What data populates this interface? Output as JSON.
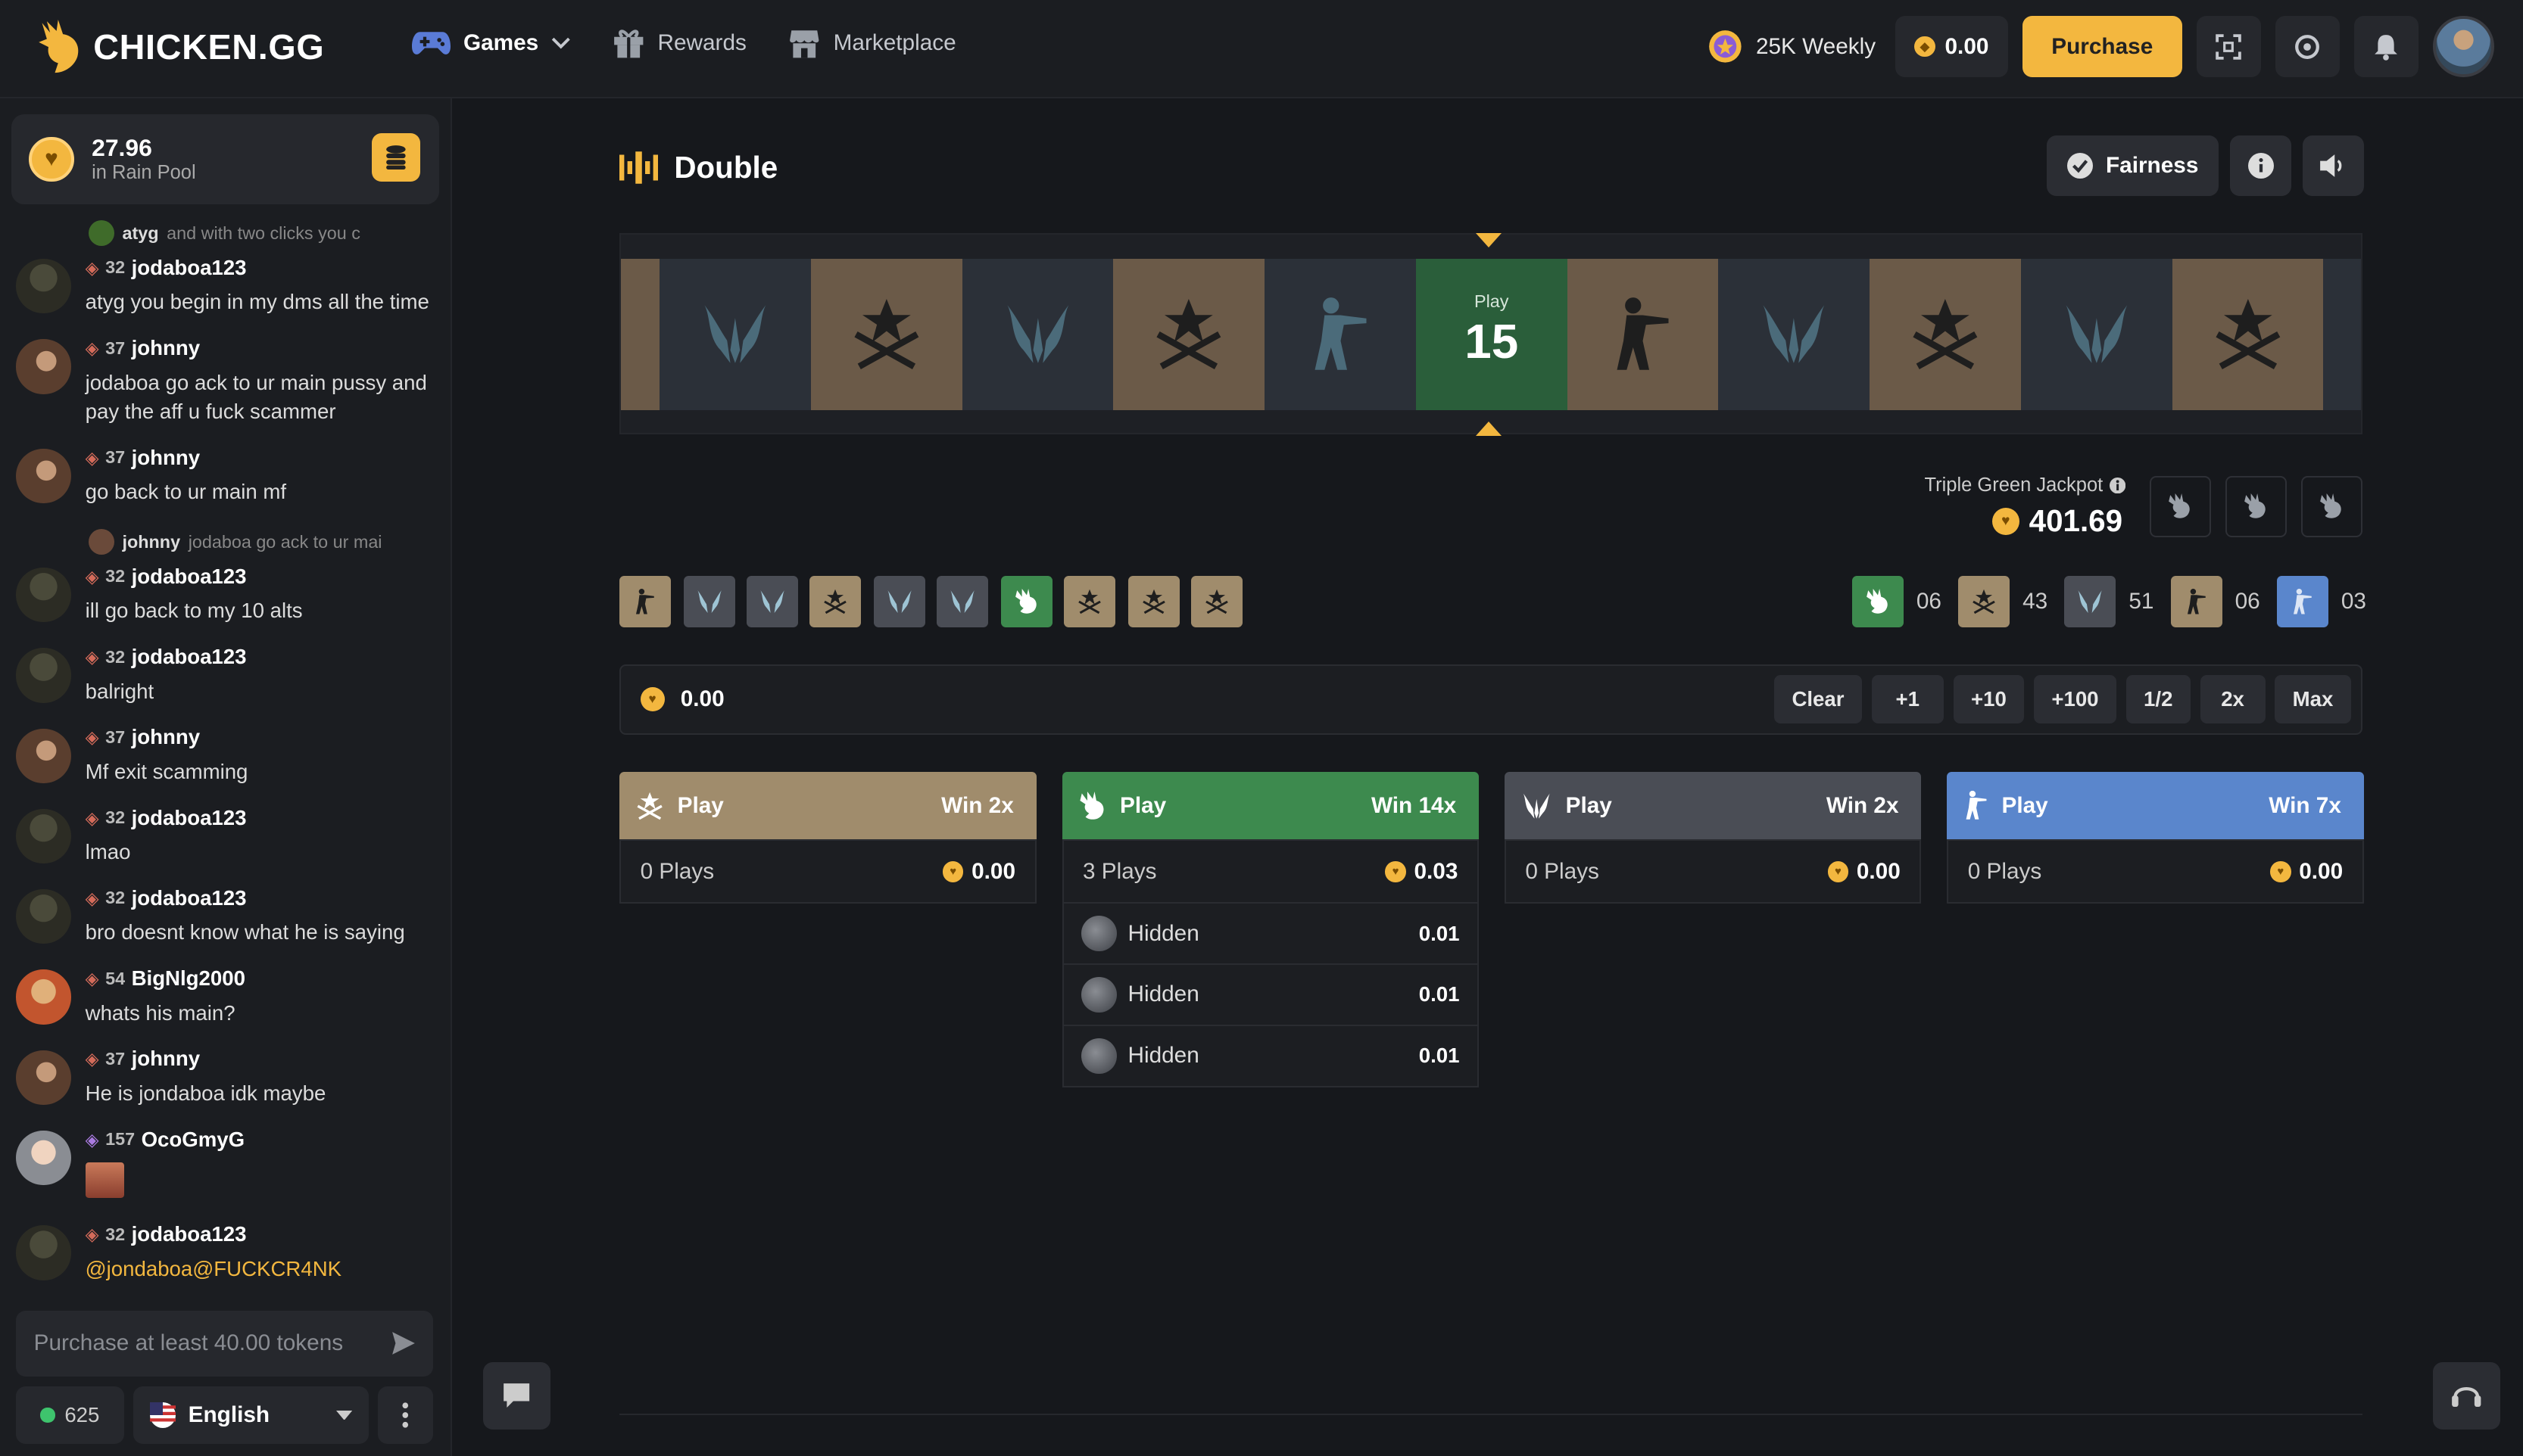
{
  "brand": {
    "name": "CHICKEN.GG"
  },
  "nav": {
    "games": "Games",
    "rewards": "Rewards",
    "marketplace": "Marketplace"
  },
  "topbar": {
    "weekly": "25K Weekly",
    "balance": "0.00",
    "purchase": "Purchase"
  },
  "rain": {
    "amount": "27.96",
    "label": "in Rain Pool"
  },
  "chat": {
    "messages": [
      {
        "reply": {
          "user": "atyg",
          "text": "and with two clicks you c"
        },
        "level": "32",
        "user": "jodaboa123",
        "text": "atyg you begin in my dms all the time"
      },
      {
        "level": "37",
        "user": "johnny",
        "text": "jodaboa go ack to ur main pussy and pay the aff u fuck scammer"
      },
      {
        "level": "37",
        "user": "johnny",
        "text": "go back to ur main mf"
      },
      {
        "reply": {
          "user": "johnny",
          "text": "jodaboa go ack to ur mai"
        },
        "level": "32",
        "user": "jodaboa123",
        "text": "ill go back to my 10 alts"
      },
      {
        "level": "32",
        "user": "jodaboa123",
        "text": "balright"
      },
      {
        "level": "37",
        "user": "johnny",
        "text": "Mf exit scamming"
      },
      {
        "level": "32",
        "user": "jodaboa123",
        "text": "lmao"
      },
      {
        "level": "32",
        "user": "jodaboa123",
        "text": "bro doesnt know what he is saying"
      },
      {
        "level": "54",
        "user": "BigNlg2000",
        "text": "whats his main?"
      },
      {
        "level": "37",
        "user": "johnny",
        "text": "He is jondaboa idk maybe"
      },
      {
        "level": "157",
        "user": "OcoGmyG",
        "text": ""
      },
      {
        "level": "32",
        "user": "jodaboa123",
        "text": "@jondaboa@FUCKCR4NK"
      }
    ],
    "input_placeholder": "Purchase at least 40.00 tokens",
    "online": "625",
    "language": "English"
  },
  "game": {
    "title": "Double",
    "fairness": "Fairness",
    "roll": {
      "label": "Play",
      "number": "15"
    },
    "jackpot": {
      "label": "Triple Green Jackpot",
      "amount": "401.69"
    },
    "stats": [
      {
        "kind": "green",
        "count": "06"
      },
      {
        "kind": "t",
        "count": "43"
      },
      {
        "kind": "ct",
        "count": "51"
      },
      {
        "kind": "t-soldier",
        "count": "06"
      },
      {
        "kind": "ct-soldier",
        "count": "03"
      }
    ],
    "bet": {
      "amount": "0.00",
      "chips": [
        "Clear",
        "+1",
        "+10",
        "+100",
        "1/2",
        "2x",
        "Max"
      ]
    },
    "columns": [
      {
        "play": "Play",
        "win": "Win 2x",
        "plays": "0 Plays",
        "total": "0.00",
        "color": "#a08c6c",
        "entries": []
      },
      {
        "play": "Play",
        "win": "Win 14x",
        "plays": "3 Plays",
        "total": "0.03",
        "color": "#3d8a4e",
        "entries": [
          {
            "name": "Hidden",
            "value": "0.01"
          },
          {
            "name": "Hidden",
            "value": "0.01"
          },
          {
            "name": "Hidden",
            "value": "0.01"
          }
        ]
      },
      {
        "play": "Play",
        "win": "Win 2x",
        "plays": "0 Plays",
        "total": "0.00",
        "color": "#4a4d55",
        "entries": []
      },
      {
        "play": "Play",
        "win": "Win 7x",
        "plays": "0 Plays",
        "total": "0.00",
        "color": "#5a86cc",
        "entries": []
      }
    ]
  },
  "colors": {
    "accent": "#f3b73f",
    "green": "#3d8a4e",
    "t": "#a08c6c",
    "ct": "#4a4d55",
    "blue": "#5a86cc"
  }
}
